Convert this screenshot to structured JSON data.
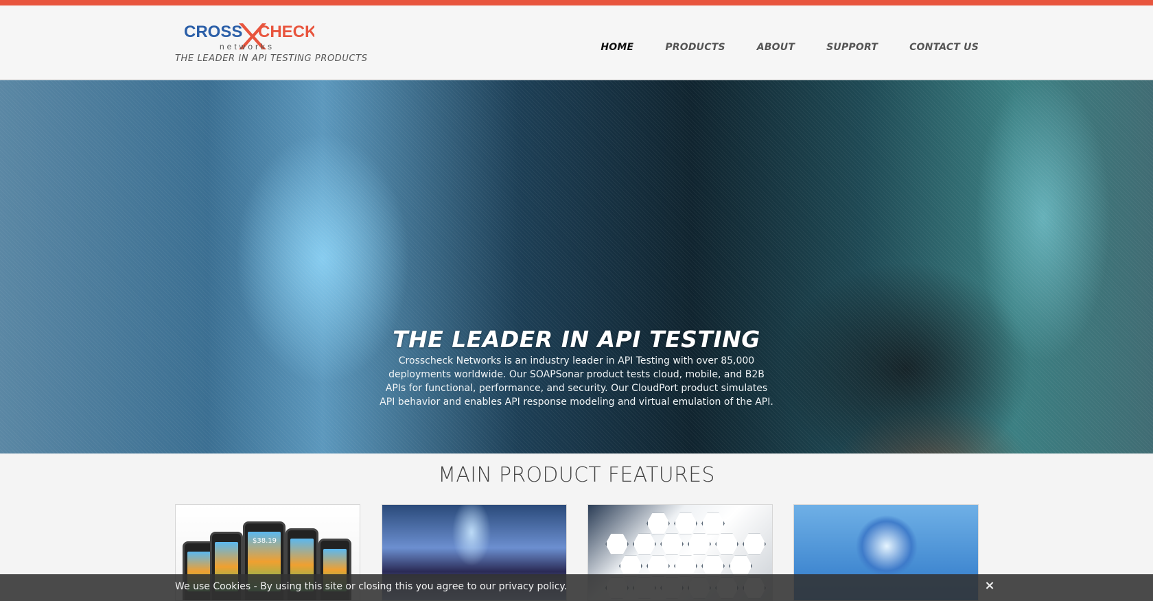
{
  "brand": {
    "logo_word_1": "CROSS",
    "logo_word_2": "CHECK",
    "logo_sub": "networks",
    "tagline": "THE LEADER IN API TESTING PRODUCTS"
  },
  "nav": {
    "items": [
      {
        "label": "HOME",
        "active": true
      },
      {
        "label": "PRODUCTS"
      },
      {
        "label": "ABOUT"
      },
      {
        "label": "SUPPORT"
      },
      {
        "label": "CONTACT US"
      }
    ]
  },
  "hero": {
    "title": "THE LEADER IN API TESTING",
    "body": "Crosscheck Networks is an industry leader in API Testing with over 85,000 deployments worldwide. Our SOAPSonar product tests cloud, mobile, and B2B APIs for functional, performance, and security. Our CloudPort product simulates API behavior and enables API response modeling and virtual emulation of the API."
  },
  "features": {
    "title": "MAIN PRODUCT FEATURES",
    "cards": [
      {
        "image": "mobile-phones-image",
        "screen_text": "$38.19"
      },
      {
        "image": "cloud-data-image"
      },
      {
        "image": "security-hexagons-image"
      },
      {
        "image": "globe-hands-image"
      }
    ]
  },
  "cookie": {
    "text": "We use Cookies - By using this site or closing this you agree to our privacy policy.",
    "close": "×"
  },
  "colors": {
    "accent": "#e8553e",
    "logo_blue": "#2b5fa8",
    "logo_orange": "#e8553e"
  }
}
